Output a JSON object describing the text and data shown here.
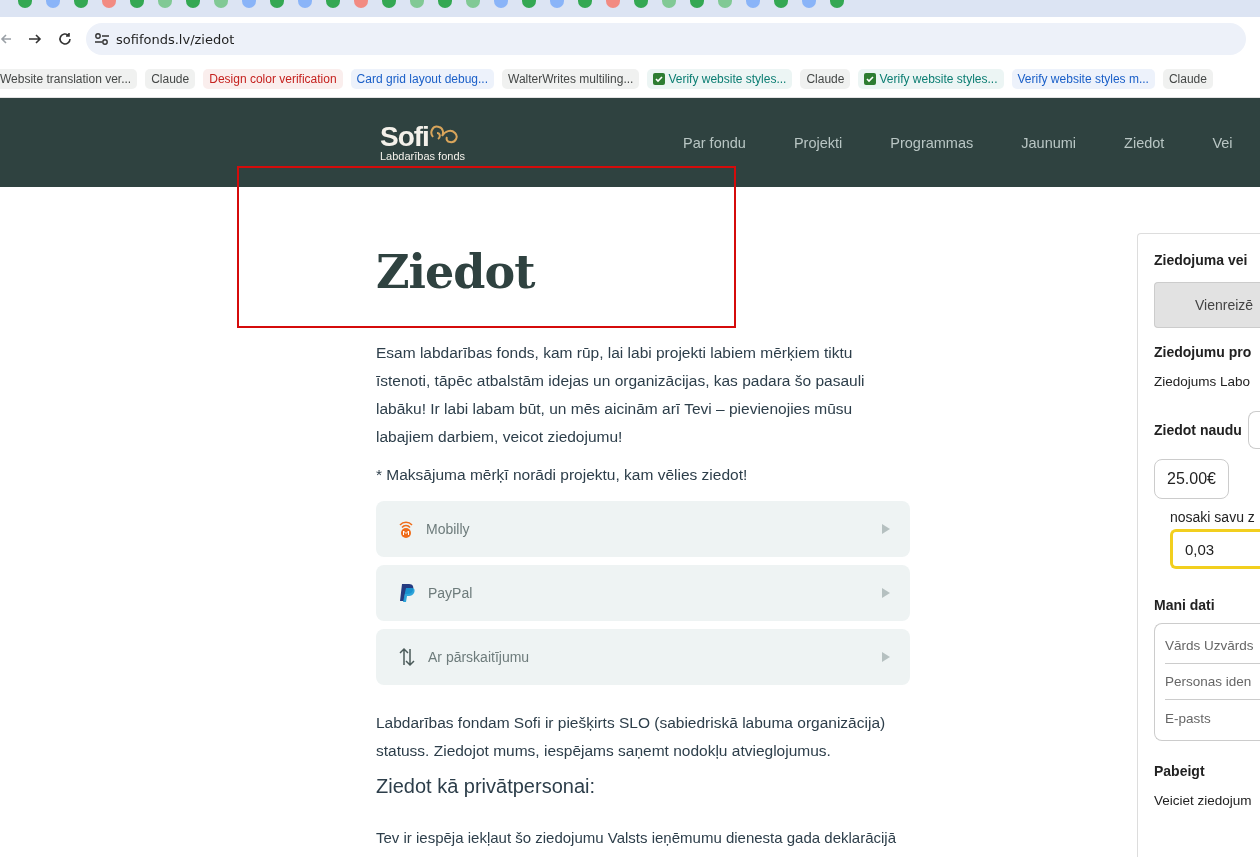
{
  "browser": {
    "url": "sofifonds.lv/ziedot",
    "bookmarks": [
      {
        "label": "Website translation ver...",
        "color": "#444746",
        "kind": "plain"
      },
      {
        "label": "Claude",
        "color": "#444746",
        "kind": "plain"
      },
      {
        "label": "Design color verification",
        "color": "#c5221f",
        "kind": "plain"
      },
      {
        "label": "Card grid layout debug...",
        "color": "#1a5fc8",
        "kind": "plain"
      },
      {
        "label": "WalterWrites multiling...",
        "color": "#444746",
        "kind": "plain"
      },
      {
        "label": "Verify website styles...",
        "color": "#0b7d72",
        "kind": "check"
      },
      {
        "label": "Claude",
        "color": "#444746",
        "kind": "plain"
      },
      {
        "label": "Verify website styles...",
        "color": "#0b7d72",
        "kind": "check"
      },
      {
        "label": "Verify website styles m...",
        "color": "#1a5fc8",
        "kind": "plain"
      },
      {
        "label": "Claude",
        "color": "#444746",
        "kind": "plain"
      }
    ]
  },
  "site": {
    "logo": "Sofi",
    "logo_sub": "Labdarības fonds",
    "nav": [
      {
        "label": "Par fondu",
        "selected": false
      },
      {
        "label": "Projekti",
        "selected": false
      },
      {
        "label": "Programmas",
        "selected": false
      },
      {
        "label": "Jaunumi",
        "selected": false
      },
      {
        "label": "Ziedot",
        "selected": false
      },
      {
        "label": "Vei",
        "selected": false
      }
    ]
  },
  "main": {
    "title": "Ziedot",
    "intro": "Esam labdarības fonds, kam rūp, lai labi projekti labiem mērķiem tiktu īstenoti, tāpēc atbalstām idejas un organizācijas, kas padara šo pasauli labāku! Ir labi labam būt, un mēs aicinām arī Tevi – pievienojies mūsu labajiem darbiem, veicot ziedojumu!",
    "note": "* Maksājuma mērķī norādi projektu, kam vēlies ziedot!",
    "payment_methods": [
      {
        "label": "Mobilly",
        "kind": "mobilly",
        "expanded": false
      },
      {
        "label": "PayPal",
        "kind": "paypal",
        "expanded": false
      },
      {
        "label": "Ar pārskaitījumu",
        "kind": "transfer",
        "expanded": false
      }
    ],
    "status_text": "Labdarības fondam Sofi ir piešķirts SLO (sabiedriskā labuma organizācija) statuss. Ziedojot mums, iespējams saņemt nodokļu atvieglojumus.",
    "subheading": "Ziedot kā privātpersonai:",
    "private_text": "Tev ir iespēja iekļaut šo ziedojumu Valsts ieņēmumu dienesta gada deklarācijā"
  },
  "donation_form": {
    "type_label": "Ziedojuma vei",
    "type_button": "Vienreizē",
    "project_label": "Ziedojumu pro",
    "project_value": "Ziedojums Labo",
    "amount_label": "Ziedot naudu",
    "amount_option": "25.00€",
    "custom_label": "nosaki savu z",
    "custom_value": "0,03",
    "my_data_label": "Mani dati",
    "fields": [
      {
        "placeholder": "Vārds Uzvārds"
      },
      {
        "placeholder": "Personas iden"
      },
      {
        "placeholder": "E-pasts"
      }
    ],
    "finish_label": "Pabeigt",
    "finish_text": "Veiciet ziedojum"
  }
}
